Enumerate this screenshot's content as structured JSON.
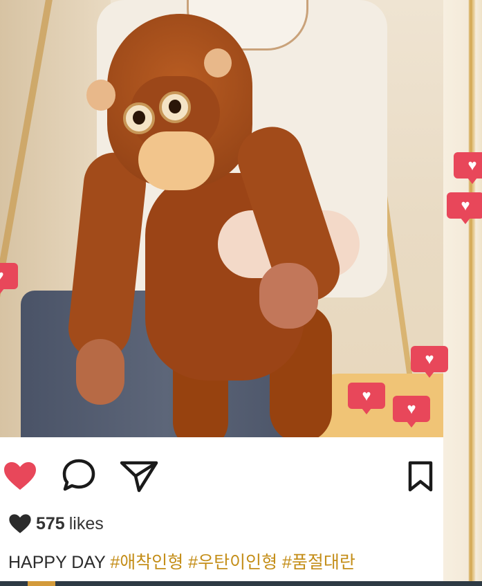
{
  "post": {
    "likes_count": "575",
    "likes_label": "likes",
    "caption_text": "HAPPY DAY",
    "hashtags": [
      "#애착인형",
      "#우탄이인형",
      "#품절대란"
    ]
  },
  "icons": {
    "like": "heart-filled-icon",
    "comment": "speech-bubble-icon",
    "share": "paper-plane-icon",
    "bookmark": "bookmark-icon",
    "likes_heart": "small-heart-icon"
  },
  "colors": {
    "like_red": "#e8475a",
    "hashtag_gold": "#c48e19",
    "frame_gold": "#d6ad5c"
  }
}
